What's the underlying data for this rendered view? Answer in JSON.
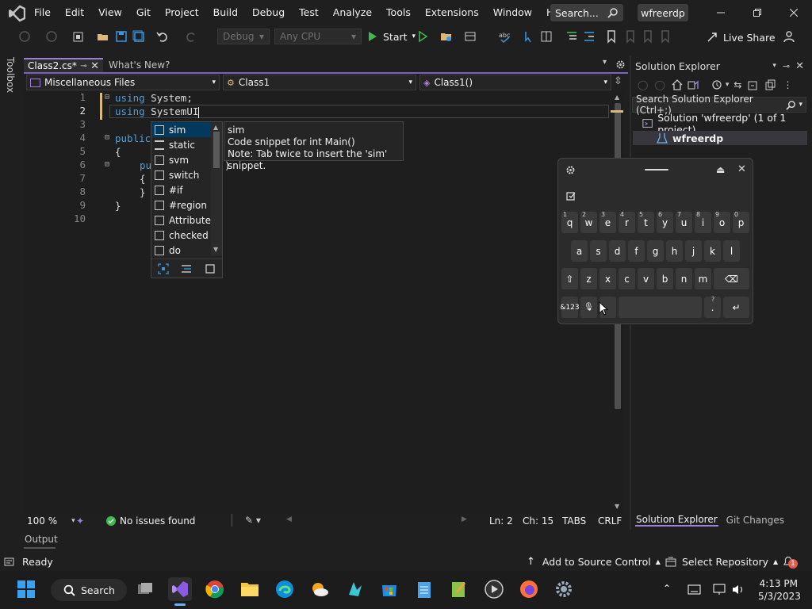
{
  "menu": [
    "File",
    "Edit",
    "View",
    "Git",
    "Project",
    "Build",
    "Debug",
    "Test",
    "Analyze",
    "Tools",
    "Extensions",
    "Window",
    "Help"
  ],
  "search": {
    "label": "Search..."
  },
  "solution_name": "wfreerdp",
  "toolbar": {
    "config": "Debug",
    "platform": "Any CPU",
    "start_label": "Start",
    "live_share": "Live Share"
  },
  "toolbox_label": "Toolbox",
  "tabs": {
    "active": "Class2.cs*",
    "inactive": "What's New?"
  },
  "navbar": {
    "project": "Miscellaneous Files",
    "type": "Class1",
    "member": "Class1()"
  },
  "editor": {
    "line_numbers": [
      "1",
      "2",
      "3",
      "4",
      "5",
      "6",
      "7",
      "8",
      "9",
      "10"
    ],
    "line1_kw": "using",
    "line1_rest": " System;",
    "line2_kw": "using",
    "line2_rest": " SystemUI",
    "line4_kw": "public",
    "line5": "{",
    "line6_kw": "pu",
    "line6_rest": ")",
    "line7": "{",
    "line8": "}",
    "line9": "}"
  },
  "intellisense": {
    "items": [
      "sim",
      "static",
      "svm",
      "switch",
      "#if",
      "#region",
      "Attribute",
      "checked",
      "do"
    ],
    "tooltip_title": "sim",
    "tooltip_line1": "Code snippet for int Main()",
    "tooltip_line2": "Note: Tab twice to insert the 'sim' snippet."
  },
  "editor_status": {
    "zoom": "100 %",
    "issues": "No issues found",
    "ln": "Ln: 2",
    "ch": "Ch: 15",
    "tabs": "TABS",
    "eol": "CRLF"
  },
  "output_tab": "Output",
  "solution_explorer": {
    "title": "Solution Explorer",
    "search_placeholder": "Search Solution Explorer (Ctrl+;)",
    "solution_node": "Solution 'wfreerdp' (1 of 1 project)",
    "project_node": "wfreerdp",
    "bottom_tab_active": "Solution Explorer",
    "bottom_tab_inactive": "Git Changes"
  },
  "osk": {
    "row1": [
      [
        "q",
        "1"
      ],
      [
        "w",
        "2"
      ],
      [
        "e",
        "3"
      ],
      [
        "r",
        "4"
      ],
      [
        "t",
        "5"
      ],
      [
        "y",
        "6"
      ],
      [
        "u",
        "7"
      ],
      [
        "i",
        "8"
      ],
      [
        "o",
        "9"
      ],
      [
        "p",
        "0"
      ]
    ],
    "row2": [
      "a",
      "s",
      "d",
      "f",
      "g",
      "h",
      "j",
      "k",
      "l"
    ],
    "row3": [
      "z",
      "x",
      "c",
      "v",
      "b",
      "n",
      "m"
    ],
    "sym_key": "&123",
    "period_key": ".",
    "period_alt": "?"
  },
  "statusbar": {
    "ready": "Ready",
    "source_control": "Add to Source Control",
    "repository": "Select Repository",
    "notifications": "1"
  },
  "taskbar": {
    "search_label": "Search",
    "time": "4:13 PM",
    "date": "5/3/2023"
  },
  "colors": {
    "accent": "#7b61c4",
    "keyword": "#569cd6",
    "ok_green": "#3fb950"
  }
}
